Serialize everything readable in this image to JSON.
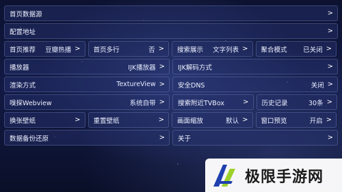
{
  "settings": {
    "home_source": {
      "label": "首页数据源",
      "chevron": ">"
    },
    "config_url": {
      "label": "配置地址",
      "chevron": ">"
    },
    "home_recommend": {
      "label": "首页推荐",
      "value": "豆瓣热播",
      "chevron": ">"
    },
    "home_multiline": {
      "label": "首页多行",
      "value": "否",
      "chevron": ">"
    },
    "search_display": {
      "label": "搜索展示",
      "value": "文字列表",
      "chevron": ">"
    },
    "aggregate_mode": {
      "label": "聚合模式",
      "value": "已关闭",
      "chevron": ">"
    },
    "player": {
      "label": "播放器",
      "value": "IJK播放器",
      "chevron": ">"
    },
    "ijk_decode": {
      "label": "IJK解码方式",
      "chevron": ">"
    },
    "render_mode": {
      "label": "渲染方式",
      "value": "TextureView",
      "chevron": ">"
    },
    "secure_dns": {
      "label": "安全DNS",
      "value": "关闭",
      "chevron": ">"
    },
    "sniff_webview": {
      "label": "嗅探Webview",
      "value": "系统自带",
      "chevron": ">"
    },
    "search_tvbox": {
      "label": "搜索附近TVBox",
      "chevron": ">"
    },
    "history": {
      "label": "历史记录",
      "value": "30条",
      "chevron": ">"
    },
    "change_wallpaper": {
      "label": "换张壁纸",
      "chevron": ">"
    },
    "reset_wallpaper": {
      "label": "重置壁纸",
      "chevron": ">"
    },
    "screen_scale": {
      "label": "画面缩放",
      "value": "默认",
      "chevron": ">"
    },
    "window_preview": {
      "label": "窗口预览",
      "value": "开启",
      "chevron": ">"
    },
    "backup_restore": {
      "label": "数据备份还原",
      "chevron": ">"
    },
    "about": {
      "label": "关于",
      "chevron": ">"
    }
  },
  "watermark": {
    "text": "极限手游网"
  },
  "colors": {
    "background": "#0c1230",
    "cell_bg": "#28346e",
    "text": "#eef2ff",
    "logo_blue": "#1e3fae",
    "logo_green": "#9bd12a"
  }
}
